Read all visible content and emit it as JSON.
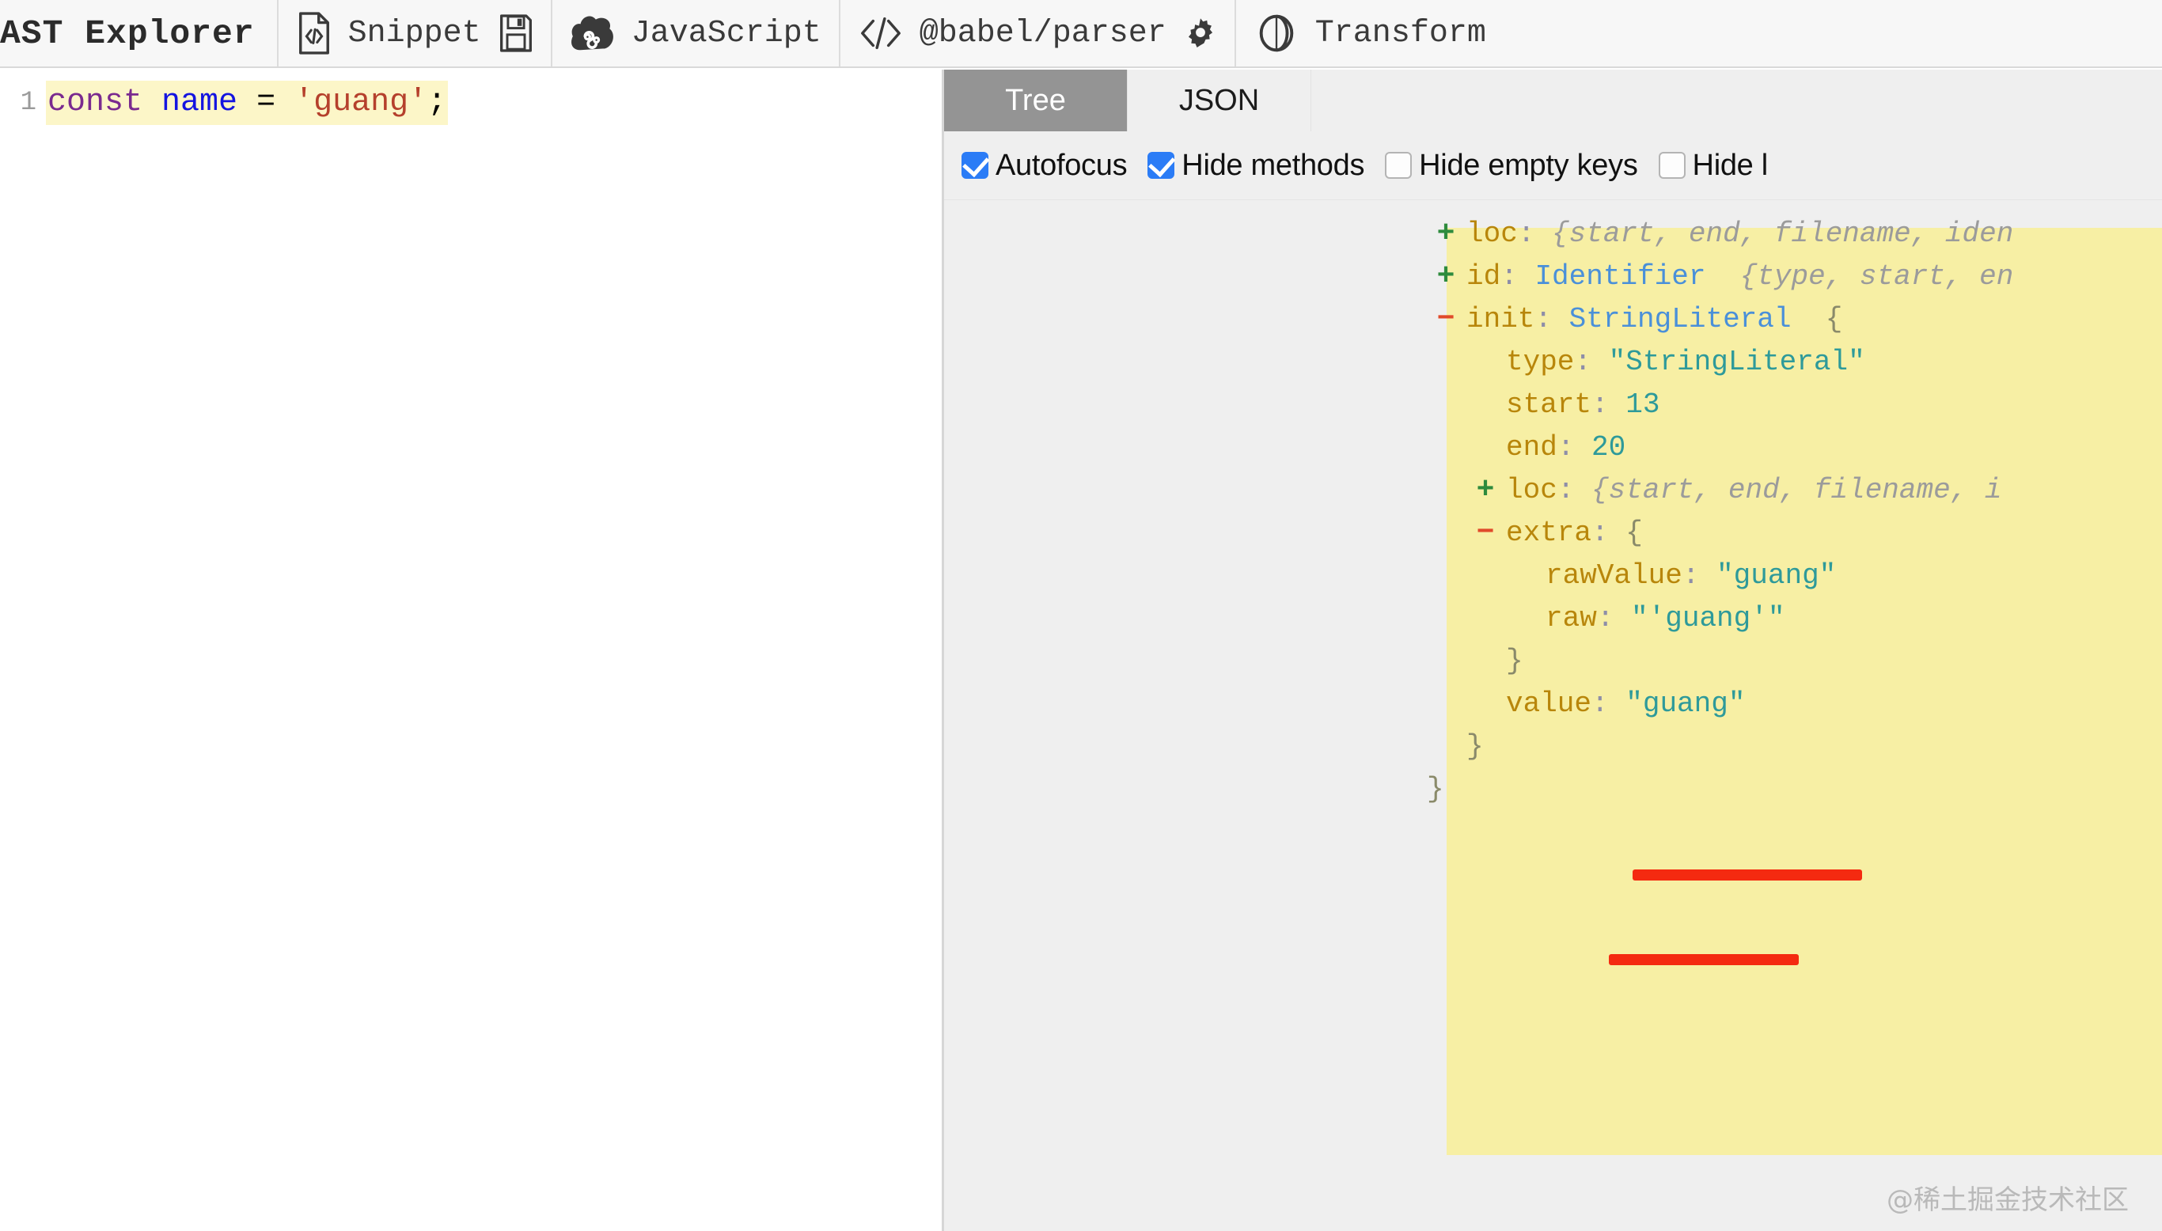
{
  "header": {
    "app_title": "AST Explorer",
    "items": [
      {
        "icon": "code-file-icon",
        "label": "Snippet",
        "trailing_icon": "save-icon"
      },
      {
        "icon": "babel-logo-icon",
        "label": "JavaScript",
        "trailing_icon": null
      },
      {
        "icon": "code-brackets-icon",
        "label": "@babel/parser",
        "trailing_icon": "gear-icon"
      },
      {
        "icon": "transform-circle-icon",
        "label": "Transform",
        "trailing_icon": null
      }
    ]
  },
  "editor": {
    "line_number": "1",
    "tokens": [
      {
        "text": "const",
        "kind": "kw"
      },
      {
        "text": " ",
        "kind": "pun"
      },
      {
        "text": "name",
        "kind": "var"
      },
      {
        "text": " ",
        "kind": "pun"
      },
      {
        "text": "=",
        "kind": "op"
      },
      {
        "text": " ",
        "kind": "pun"
      },
      {
        "text": "'guang'",
        "kind": "str"
      },
      {
        "text": ";",
        "kind": "pun"
      }
    ],
    "code": "const name = 'guang';"
  },
  "panel": {
    "tabs": [
      {
        "label": "Tree",
        "active": true
      },
      {
        "label": "JSON",
        "active": false
      }
    ],
    "options": [
      {
        "label": "Autofocus",
        "checked": true
      },
      {
        "label": "Hide methods",
        "checked": true
      },
      {
        "label": "Hide empty keys",
        "checked": false
      },
      {
        "label": "Hide l",
        "checked": false
      }
    ]
  },
  "tree": {
    "rows": [
      {
        "marker": "+",
        "indent": 0,
        "key": "loc",
        "value_type": "preview",
        "type_name": "",
        "value": "{start, end, filename, iden",
        "highlighted": false
      },
      {
        "marker": "+",
        "indent": 0,
        "key": "id",
        "value_type": "node",
        "type_name": "Identifier",
        "value": "{type, start, en",
        "highlighted": false
      },
      {
        "marker": "-",
        "indent": 0,
        "key": "init",
        "value_type": "node_open",
        "type_name": "StringLiteral",
        "value": "{",
        "highlighted": true
      },
      {
        "marker": "",
        "indent": 1,
        "key": "type",
        "value_type": "string",
        "type_name": "",
        "value": "\"StringLiteral\"",
        "highlighted": true
      },
      {
        "marker": "",
        "indent": 1,
        "key": "start",
        "value_type": "number",
        "type_name": "",
        "value": "13",
        "highlighted": true
      },
      {
        "marker": "",
        "indent": 1,
        "key": "end",
        "value_type": "number",
        "type_name": "",
        "value": "20",
        "highlighted": true
      },
      {
        "marker": "+",
        "indent": 1,
        "key": "loc",
        "value_type": "preview",
        "type_name": "",
        "value": "{start, end, filename, i",
        "highlighted": true
      },
      {
        "marker": "-",
        "indent": 1,
        "key": "extra",
        "value_type": "open",
        "type_name": "",
        "value": "{",
        "highlighted": true
      },
      {
        "marker": "",
        "indent": 2,
        "key": "rawValue",
        "value_type": "string",
        "type_name": "",
        "value": "\"guang\"",
        "highlighted": true
      },
      {
        "marker": "",
        "indent": 2,
        "key": "raw",
        "value_type": "string",
        "type_name": "",
        "value": "\"'guang'\"",
        "highlighted": true,
        "underlined": true
      },
      {
        "marker": "",
        "indent": 1,
        "key": "",
        "value_type": "close",
        "type_name": "",
        "value": "}",
        "highlighted": true
      },
      {
        "marker": "",
        "indent": 1,
        "key": "value",
        "value_type": "string",
        "type_name": "",
        "value": "\"guang\"",
        "highlighted": true,
        "underlined": true
      },
      {
        "marker": "",
        "indent": 0,
        "key": "",
        "value_type": "close",
        "type_name": "",
        "value": "}",
        "highlighted": true
      },
      {
        "marker": "",
        "indent": -1,
        "key": "",
        "value_type": "close",
        "type_name": "",
        "value": "}",
        "highlighted": false
      }
    ]
  },
  "watermark": {
    "text": "@稀土掘金技术社区"
  },
  "colors": {
    "highlight": "#f7efa4",
    "annotation_underline": "#f42a10",
    "checkbox_accent": "#2b7cf6",
    "active_tab_bg": "#949494",
    "panel_bg": "#efefef",
    "code_highlight": "#fcf6c8"
  }
}
